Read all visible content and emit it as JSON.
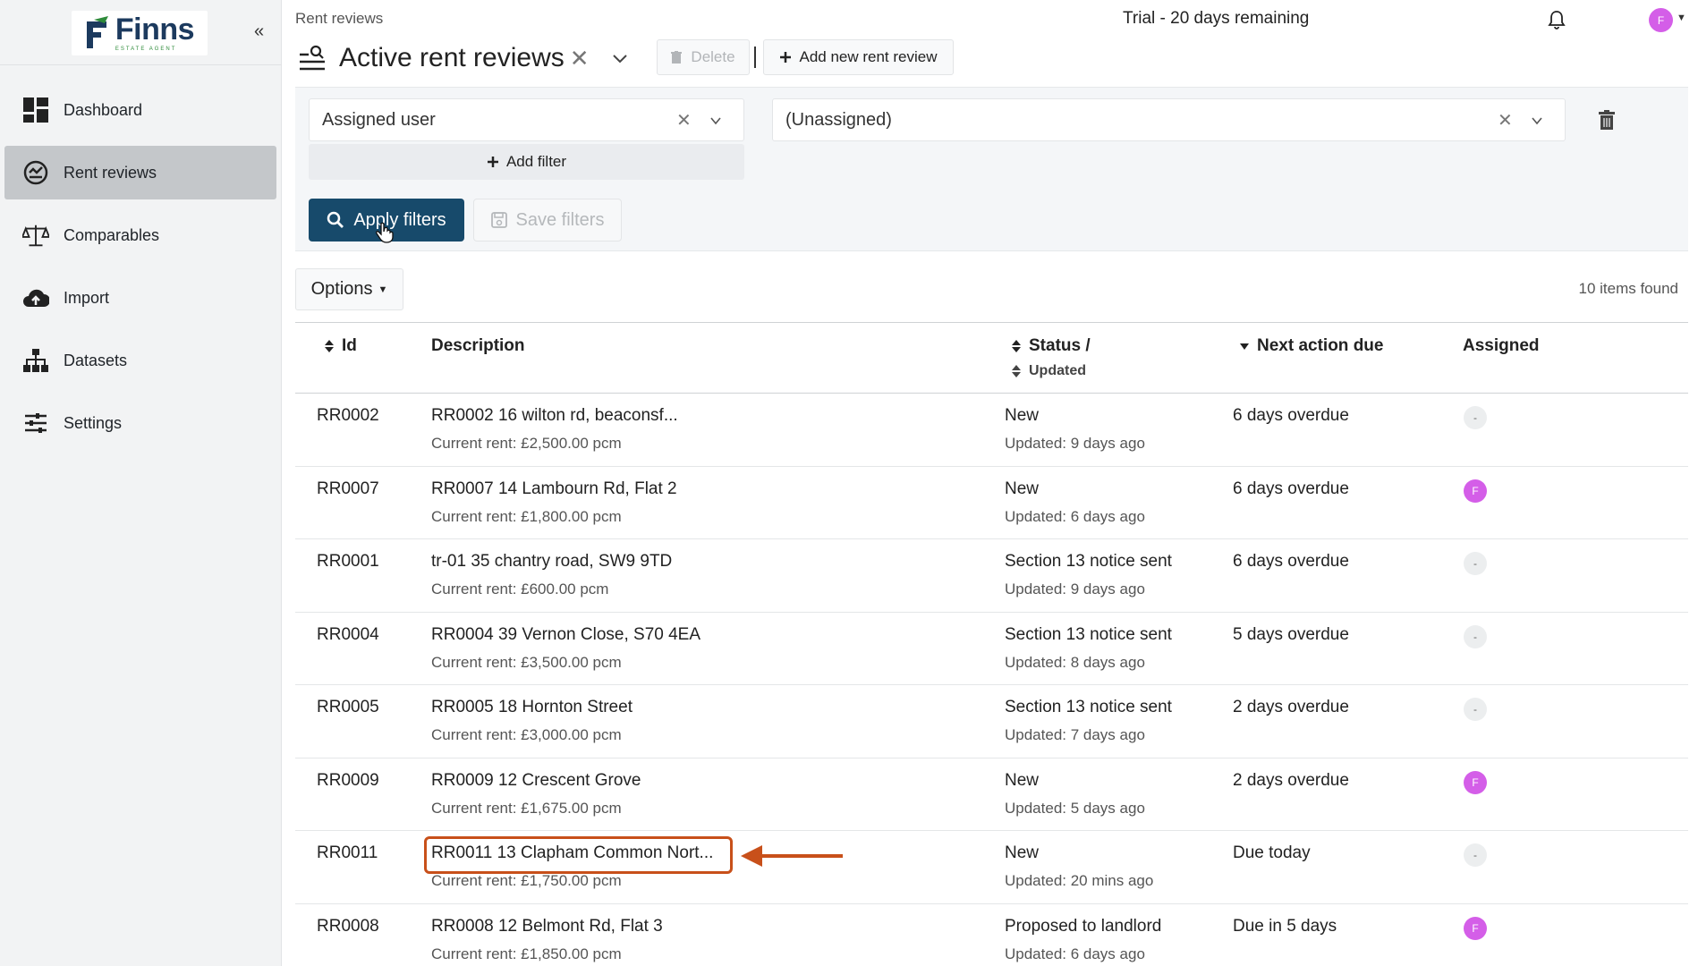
{
  "sidebar": {
    "logo_name": "Finns",
    "logo_sub": "ESTATE AGENT",
    "collapse": "«",
    "items": [
      {
        "label": "Dashboard",
        "icon": "dashboard-icon",
        "active": false
      },
      {
        "label": "Rent reviews",
        "icon": "rent-reviews-icon",
        "active": true
      },
      {
        "label": "Comparables",
        "icon": "scales-icon",
        "active": false
      },
      {
        "label": "Import",
        "icon": "cloud-upload-icon",
        "active": false
      },
      {
        "label": "Datasets",
        "icon": "sitemap-icon",
        "active": false
      },
      {
        "label": "Settings",
        "icon": "sliders-icon",
        "active": false
      }
    ]
  },
  "header": {
    "breadcrumb": "Rent reviews",
    "trial": "Trial - 20 days remaining",
    "avatar": "F",
    "title": "Active rent reviews",
    "title_close": "✕",
    "delete_label": "Delete",
    "add_label": "Add new rent review"
  },
  "filters": {
    "field": "Assigned user",
    "value": "(Unassigned)",
    "clear": "✕",
    "add_filter": "Add filter",
    "apply": "Apply filters",
    "save": "Save filters"
  },
  "toolbar": {
    "options": "Options",
    "items_found": "10 items found"
  },
  "table": {
    "columns": {
      "id": "Id",
      "description": "Description",
      "status": "Status /",
      "updated": "Updated",
      "next_action": "Next action due",
      "assigned": "Assigned"
    },
    "rows": [
      {
        "id": "RR0002",
        "desc": "RR0002 16 wilton rd, beaconsf...",
        "rent": "Current rent: £2,500.00 pcm",
        "status": "New",
        "updated": "Updated: 9 days ago",
        "next": "6 days overdue",
        "assigned": "-",
        "assigned_type": "none"
      },
      {
        "id": "RR0007",
        "desc": "RR0007 14 Lambourn Rd, Flat 2",
        "rent": "Current rent: £1,800.00 pcm",
        "status": "New",
        "updated": "Updated: 6 days ago",
        "next": "6 days overdue",
        "assigned": "F",
        "assigned_type": "user"
      },
      {
        "id": "RR0001",
        "desc": "tr-01 35 chantry road, SW9 9TD",
        "rent": "Current rent: £600.00 pcm",
        "status": "Section 13 notice sent",
        "updated": "Updated: 9 days ago",
        "next": "6 days overdue",
        "assigned": "-",
        "assigned_type": "none"
      },
      {
        "id": "RR0004",
        "desc": "RR0004 39 Vernon Close, S70 4EA",
        "rent": "Current rent: £3,500.00 pcm",
        "status": "Section 13 notice sent",
        "updated": "Updated: 8 days ago",
        "next": "5 days overdue",
        "assigned": "-",
        "assigned_type": "none"
      },
      {
        "id": "RR0005",
        "desc": "RR0005 18 Hornton Street",
        "rent": "Current rent: £3,000.00 pcm",
        "status": "Section 13 notice sent",
        "updated": "Updated: 7 days ago",
        "next": "2 days overdue",
        "assigned": "-",
        "assigned_type": "none"
      },
      {
        "id": "RR0009",
        "desc": "RR0009 12 Crescent Grove",
        "rent": "Current rent: £1,675.00 pcm",
        "status": "New",
        "updated": "Updated: 5 days ago",
        "next": "2 days overdue",
        "assigned": "F",
        "assigned_type": "user"
      },
      {
        "id": "RR0011",
        "desc": "RR0011 13 Clapham Common Nort...",
        "rent": "Current rent: £1,750.00 pcm",
        "status": "New",
        "updated": "Updated: 20 mins ago",
        "next": "Due today",
        "assigned": "-",
        "assigned_type": "none"
      },
      {
        "id": "RR0008",
        "desc": "RR0008 12 Belmont Rd, Flat 3",
        "rent": "Current rent: £1,850.00 pcm",
        "status": "Proposed to landlord",
        "updated": "Updated: 6 days ago",
        "next": "Due in 5 days",
        "assigned": "F",
        "assigned_type": "user"
      }
    ]
  },
  "colors": {
    "primary": "#174a6b",
    "avatar": "#d45ee8",
    "highlight": "#c8501a"
  }
}
